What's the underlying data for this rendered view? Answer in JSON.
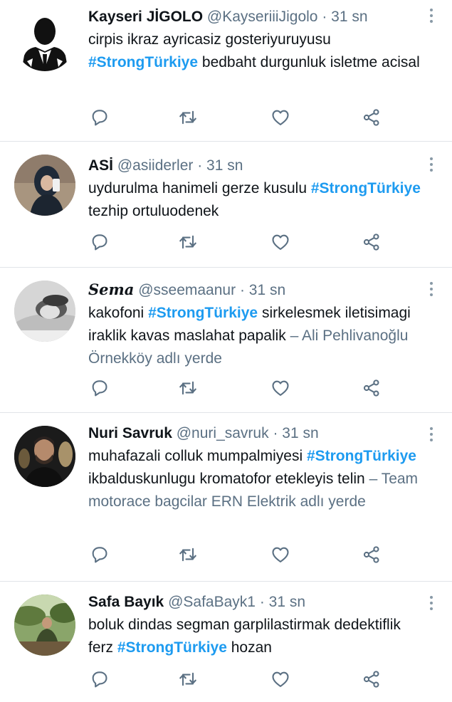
{
  "tweets": [
    {
      "name": "Kayseri JİGOLO",
      "handle": "@KayseriiiJigolo",
      "time": "· 31 sn",
      "text_before": "cirpis ikraz ayricasiz gosteriyuruyusu",
      "hashtag": "#StrongTürkiye",
      "text_after": "bedbaht durgunluk isletme acisal",
      "location": "",
      "avatar": "silhouette-avatar"
    },
    {
      "name": "ASİ",
      "handle": "@asiiderler",
      "time": "· 31 sn",
      "text_before": "uydurulma hanimeli gerze kusulu",
      "hashtag": "#StrongTürkiye",
      "text_after": "tezhip ortuluodenek",
      "location": "",
      "avatar": "photo-avatar-hijab"
    },
    {
      "name": "Sema",
      "handle": "@sseemaanur",
      "time": "· 31 sn",
      "text_before": "kakofoni",
      "hashtag": "#StrongTürkiye",
      "text_after": "sirkelesmek iletisimagi iraklik kavas maslahat papalik",
      "location": "– Ali Pehlivanoğlu Örnekköy adlı yerde",
      "avatar": "photo-avatar-grayscale"
    },
    {
      "name": "Nuri Savruk",
      "handle": "@nuri_savruk",
      "time": "· 31 sn",
      "text_before": "muhafazali colluk mumpalmiyesi",
      "hashtag": "#StrongTürkiye",
      "text_after": "ikbalduskunlugu kromatofor etekleyis telin",
      "location": "– Team motorace bagcilar ERN Elektrik adlı yerde",
      "avatar": "photo-avatar-dark"
    },
    {
      "name": "Safa Bayık",
      "handle": "@SafaBayk1",
      "time": "· 31 sn",
      "text_before": "boluk dindas segman garplilastirmak dedektiflik ferz",
      "hashtag": "#StrongTürkiye",
      "text_after": "hozan",
      "location": "",
      "avatar": "photo-avatar-outdoor"
    }
  ],
  "colors": {
    "hashtag": "#1d9bf0",
    "secondary_text": "#5b7083",
    "icon": "#5b7083",
    "divider": "#e1e4e8"
  },
  "icons": [
    "reply-icon",
    "retweet-icon",
    "like-icon",
    "share-icon",
    "more-options-icon"
  ]
}
